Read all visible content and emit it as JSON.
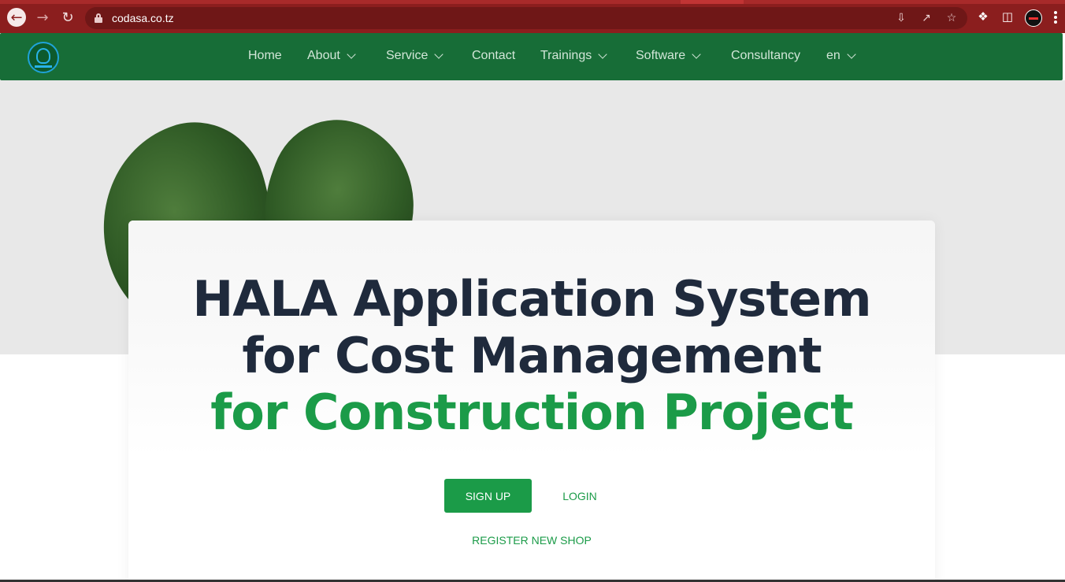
{
  "browser": {
    "url": "codasa.co.tz"
  },
  "nav": {
    "items": [
      {
        "label": "Home",
        "dropdown": false
      },
      {
        "label": "About",
        "dropdown": true
      },
      {
        "label": "Service",
        "dropdown": true
      },
      {
        "label": "Contact",
        "dropdown": false
      },
      {
        "label": "Trainings",
        "dropdown": true
      },
      {
        "label": "Software",
        "dropdown": true
      },
      {
        "label": "Consultancy",
        "dropdown": false
      },
      {
        "label": "en",
        "dropdown": true
      }
    ]
  },
  "hero": {
    "line1": "HALA Application System",
    "line2": "for Cost Management",
    "line3": "for Construction Project",
    "signup_label": "SIGN UP",
    "login_label": "LOGIN",
    "register_label": "REGISTER NEW SHOP"
  },
  "colors": {
    "chrome": "#8b1e1e",
    "nav_bg": "#176d37",
    "accent_green": "#1b9b48",
    "title_dark": "#1f2a3c"
  }
}
